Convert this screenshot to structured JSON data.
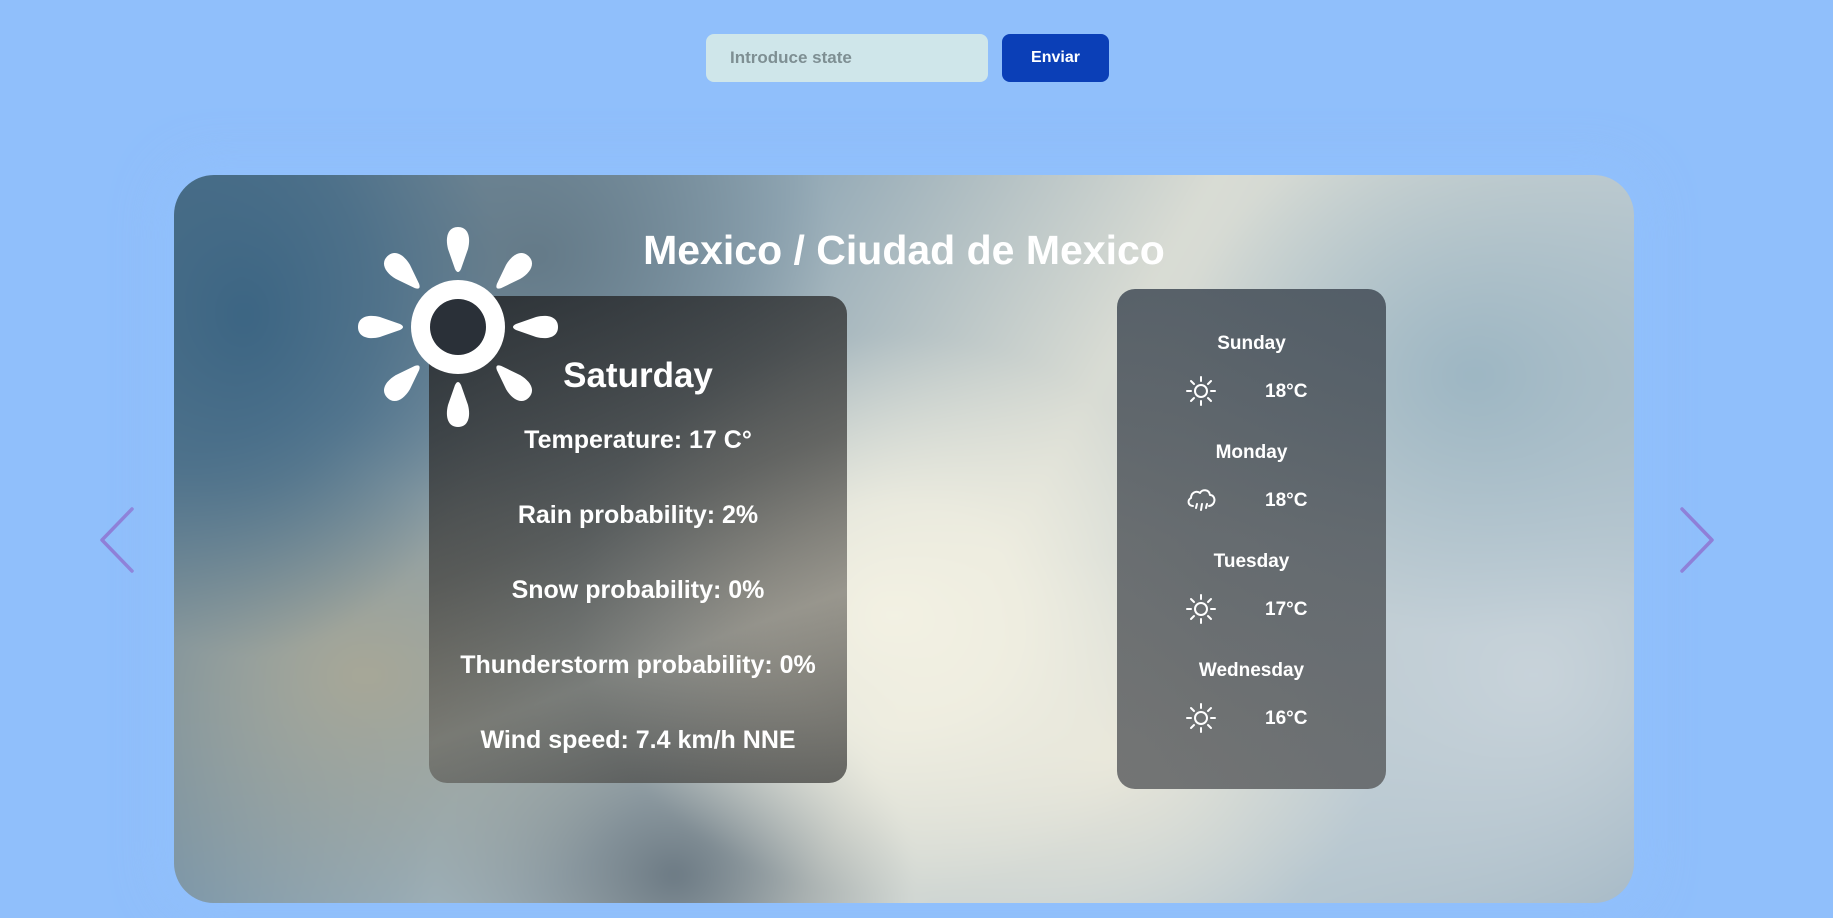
{
  "search": {
    "placeholder": "Introduce state",
    "value": "",
    "submit_label": "Enviar"
  },
  "location": {
    "title": "Mexico / Ciudad de Mexico"
  },
  "today": {
    "icon": "sun-icon",
    "day": "Saturday",
    "temperature": "Temperature: 17 C°",
    "rain": "Rain probability: 2%",
    "snow": "Snow probability: 0%",
    "thunderstorm": "Thunderstorm probability: 0%",
    "wind": "Wind speed: 7.4 km/h NNE"
  },
  "forecast": [
    {
      "day": "Sunday",
      "icon": "sun-icon",
      "temp": "18°C"
    },
    {
      "day": "Monday",
      "icon": "cloud-rain-icon",
      "temp": "18°C"
    },
    {
      "day": "Tuesday",
      "icon": "sun-icon",
      "temp": "17°C"
    },
    {
      "day": "Wednesday",
      "icon": "sun-icon",
      "temp": "16°C"
    }
  ],
  "colors": {
    "page_background": "#90bffb",
    "button_background": "#0b3fb7",
    "input_background": "#cfe6ea",
    "arrow_color": "#8f7fd8"
  }
}
